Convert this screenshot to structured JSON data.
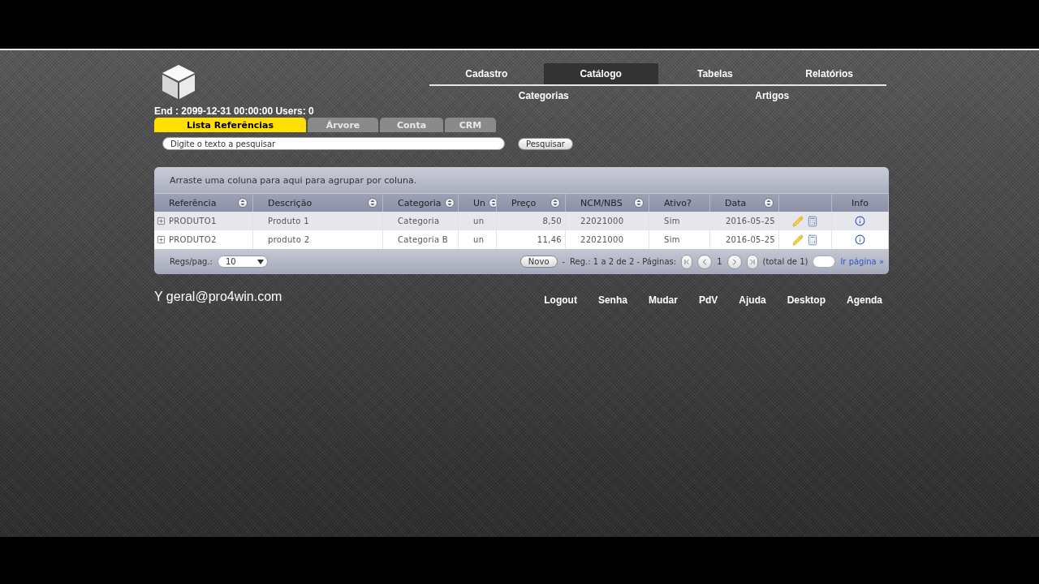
{
  "top_menu": [
    {
      "label": "Cadastro",
      "selected": false
    },
    {
      "label": "Catálogo",
      "selected": true
    },
    {
      "label": "Tabelas",
      "selected": false
    },
    {
      "label": "Relatórios",
      "selected": false
    }
  ],
  "sub_menu": [
    "Categorias",
    "Artigos"
  ],
  "status": "End : 2099-12-31 00:00:00 Users: 0",
  "tabs": [
    {
      "label": "Lista Referências",
      "selected": true
    },
    {
      "label": "Árvore",
      "selected": false
    },
    {
      "label": "Conta",
      "selected": false
    },
    {
      "label": "CRM",
      "selected": false
    }
  ],
  "search": {
    "placeholder": "Digite o texto a pesquisar",
    "button": "Pesquisar"
  },
  "grid": {
    "group_hint": "Arraste uma coluna para aqui para agrupar por coluna.",
    "columns": [
      {
        "label": "Referência",
        "sortable": true
      },
      {
        "label": "Descrição",
        "sortable": true
      },
      {
        "label": "Categoria",
        "sortable": true
      },
      {
        "label": "Un",
        "sortable": true
      },
      {
        "label": "Preço",
        "sortable": true
      },
      {
        "label": "NCM/NBS",
        "sortable": true
      },
      {
        "label": "Ativo?",
        "sortable": false
      },
      {
        "label": "Data",
        "sortable": true
      },
      {
        "sortable": false
      },
      {
        "label": "Info",
        "sortable": false
      }
    ],
    "rows": [
      {
        "cells": [
          "PRODUTO1",
          "Produto 1",
          "Categoria",
          "un",
          "8,50",
          "22021000",
          "Sim",
          "2016-05-25"
        ]
      },
      {
        "cells": [
          "PRODUTO2",
          "produto 2",
          "Categoria B",
          "un",
          "11,46",
          "22021000",
          "Sim",
          "2016-05-25"
        ]
      }
    ],
    "pager": {
      "size_label": "Regs/pag.:",
      "size_value": "10",
      "new_button": "Novo",
      "dash": "-",
      "summary": "Reg.: 1 a 2 de 2 - Páginas:",
      "page": "1",
      "total": "(total de 1)",
      "goto_link": "Ir página »"
    }
  },
  "user": "Y geral@pro4win.com",
  "footer_links": [
    "Logout",
    "Senha",
    "Mudar",
    "PdV",
    "Ajuda",
    "Desktop",
    "Agenda"
  ]
}
